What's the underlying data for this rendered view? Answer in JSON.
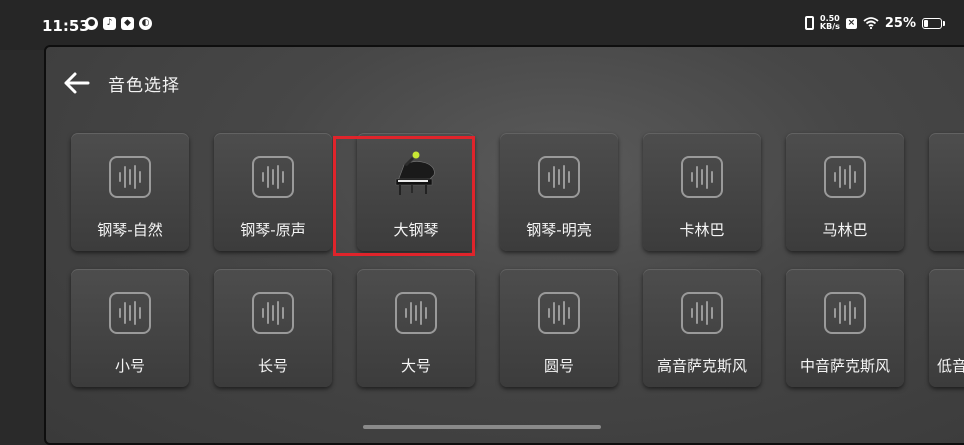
{
  "status_bar": {
    "time": "11:53",
    "left_icons": [
      "wechat-icon",
      "tiktok-icon",
      "shield-app-icon",
      "browser-app-icon"
    ],
    "net_speed_value": "0.50",
    "net_speed_unit": "KB/s",
    "battery_percent_text": "25%",
    "battery_level": 0.25
  },
  "header": {
    "title": "音色选择"
  },
  "tiles": [
    {
      "label": "钢琴-自然",
      "icon": "waveform-icon"
    },
    {
      "label": "钢琴-原声",
      "icon": "waveform-icon"
    },
    {
      "label": "大钢琴",
      "icon": "grand-piano-icon",
      "selected": true
    },
    {
      "label": "钢琴-明亮",
      "icon": "waveform-icon"
    },
    {
      "label": "卡林巴",
      "icon": "waveform-icon"
    },
    {
      "label": "马林巴",
      "icon": "waveform-icon"
    },
    {
      "label": "",
      "icon": "waveform-icon"
    },
    {
      "label": "小号",
      "icon": "waveform-icon"
    },
    {
      "label": "长号",
      "icon": "waveform-icon"
    },
    {
      "label": "大号",
      "icon": "waveform-icon"
    },
    {
      "label": "圆号",
      "icon": "waveform-icon"
    },
    {
      "label": "高音萨克斯风",
      "icon": "waveform-icon"
    },
    {
      "label": "中音萨克斯风",
      "icon": "waveform-icon"
    },
    {
      "label": "低音",
      "icon": "waveform-icon"
    }
  ],
  "colors": {
    "selection_outline": "#e0242b",
    "panel_background": "#474747",
    "tile_background": "#444444",
    "text": "#f5f5f5"
  }
}
